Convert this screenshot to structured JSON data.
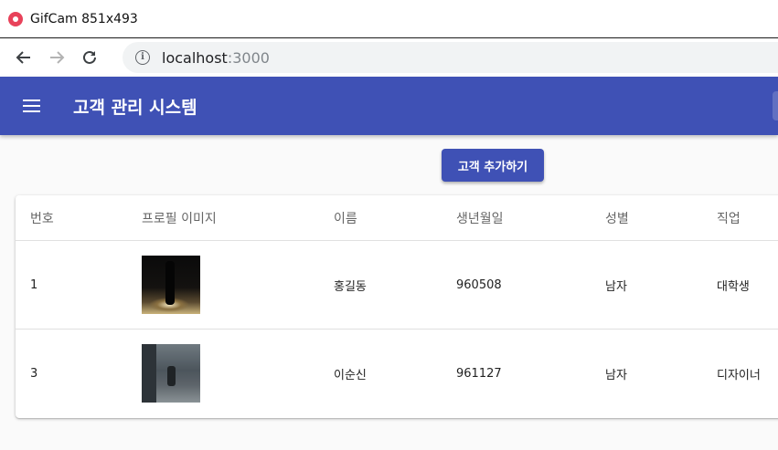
{
  "window": {
    "title": "GifCam 851x493"
  },
  "browser": {
    "url_host": "localhost",
    "url_port": ":3000"
  },
  "appbar": {
    "title": "고객 관리 시스템"
  },
  "actions": {
    "add_label": "고객 추가하기"
  },
  "table": {
    "headers": [
      "번호",
      "프로필 이미지",
      "이름",
      "생년월일",
      "성별",
      "직업"
    ],
    "rows": [
      {
        "id": "1",
        "name": "홍길동",
        "birthday": "960508",
        "gender": "남자",
        "job": "대학생"
      },
      {
        "id": "3",
        "name": "이순신",
        "birthday": "961127",
        "gender": "남자",
        "job": "디자이너"
      }
    ]
  },
  "colors": {
    "primary": "#3f51b5",
    "gifcam_icon": "#e8425a"
  },
  "icons": [
    "gifcam-icon",
    "back-arrow-icon",
    "forward-arrow-icon",
    "reload-icon",
    "info-icon",
    "menu-icon"
  ]
}
